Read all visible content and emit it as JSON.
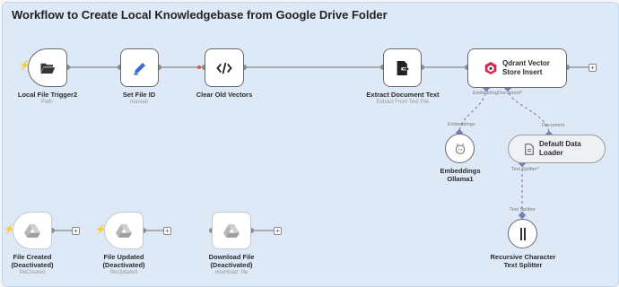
{
  "workflow": {
    "title": "Workflow to Create Local Knowledgebase from Google Drive Folder"
  },
  "nodes": {
    "local_file_trigger": {
      "label": "Local File Trigger2",
      "sub": "Path:"
    },
    "set_file_id": {
      "label": "Set File ID",
      "sub": "manual"
    },
    "clear_old_vectors": {
      "label": "Clear Old Vectors"
    },
    "extract_document_text": {
      "label": "Extract Document Text",
      "sub": "Extract From Text File"
    },
    "qdrant_vector_store_insert": {
      "label_line1": "Qdrant Vector",
      "label_line2": "Store Insert"
    },
    "embeddings_ollama": {
      "label_line1": "Embeddings",
      "label_line2": "Ollama1"
    },
    "default_data_loader": {
      "label_line1": "Default Data",
      "label_line2": "Loader"
    },
    "recursive_text_splitter": {
      "label_line1": "Recursive Character",
      "label_line2": "Text Splitter"
    },
    "file_created": {
      "label_line1": "File Created",
      "label_line2": "(Deactivated)",
      "sub": "fileCreated"
    },
    "file_updated": {
      "label_line1": "File Updated",
      "label_line2": "(Deactivated)",
      "sub": "fileUpdated"
    },
    "download_file": {
      "label_line1": "Download File",
      "label_line2": "(Deactivated)",
      "sub": "download: file"
    }
  },
  "ports": {
    "embedding": "Embedding",
    "document": "Document*",
    "embeddings": "Embeddings",
    "document2": "Document",
    "text_splitter_out": "Text Splitter*",
    "text_splitter_in": "Text Splitter"
  },
  "icons": {
    "trigger": "folder-open-icon",
    "set": "pen-icon",
    "clear": "code-icon",
    "extract": "file-export-icon",
    "qdrant": "qdrant-icon",
    "embeddings": "robot-icon",
    "loader": "document-icon",
    "splitter": "text-splitter-icon",
    "drive": "google-drive-icon"
  },
  "colors": {
    "canvas_group": "#dde9f7",
    "trigger_bolt": "#e8533c",
    "ai_connector": "#7b7bb4",
    "set_icon": "#3b6bd6"
  }
}
